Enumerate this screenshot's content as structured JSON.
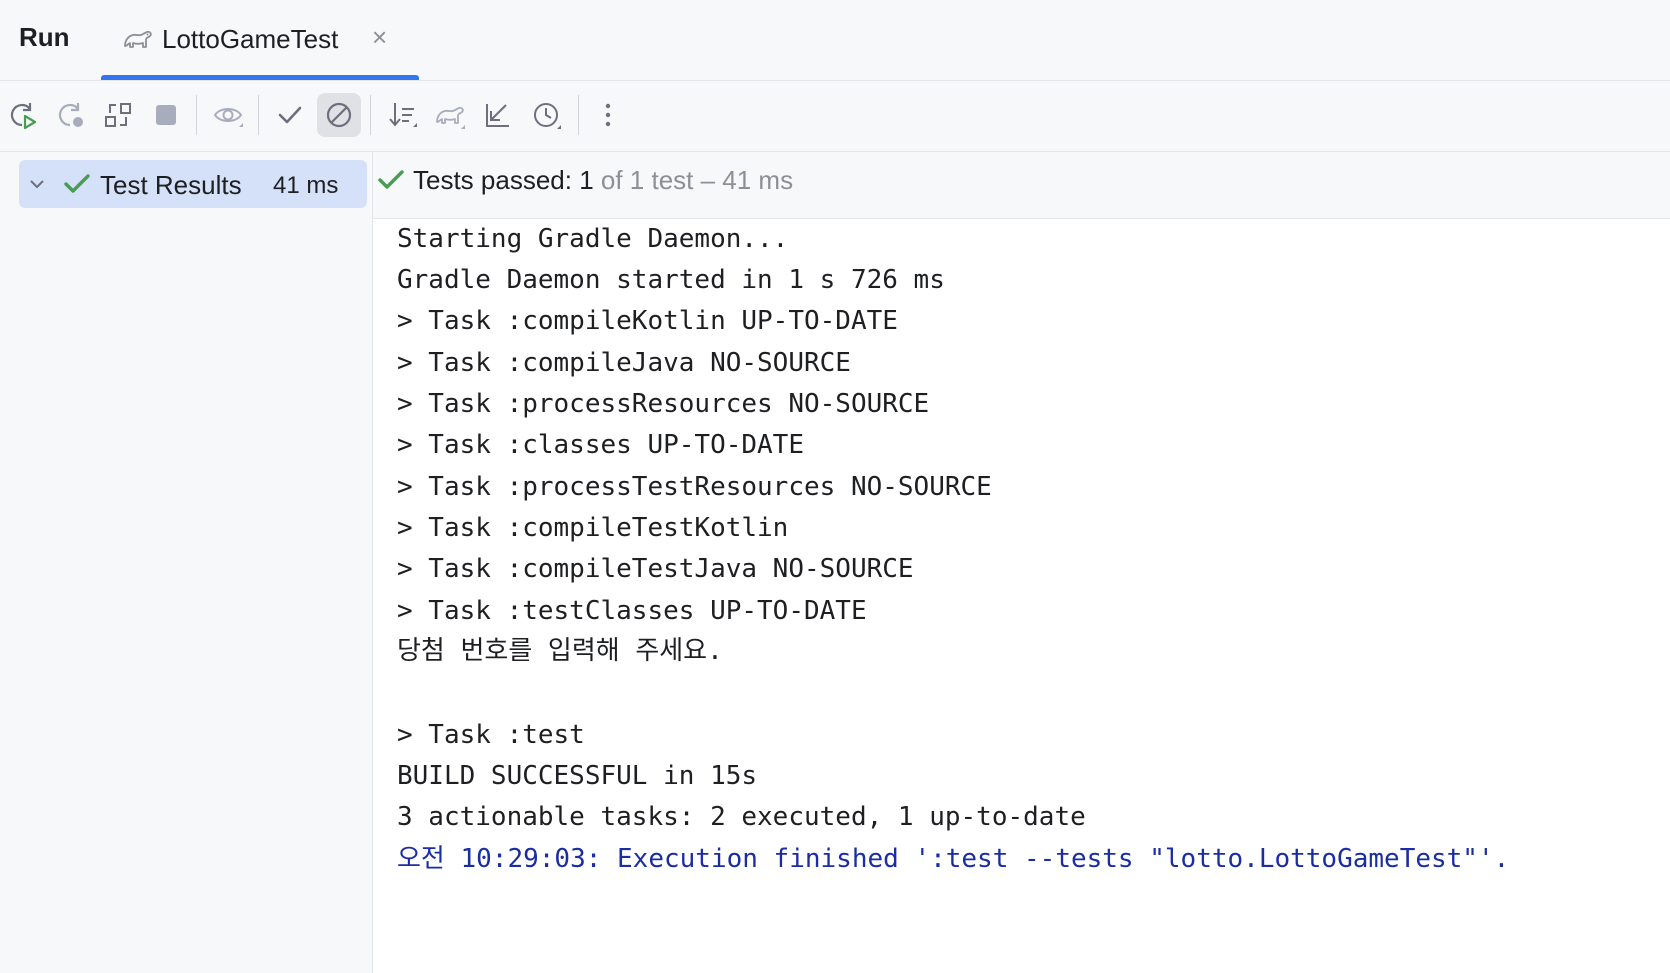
{
  "header": {
    "run_label": "Run",
    "tab_title": "LottoGameTest",
    "tab_close": "×",
    "tab_icon": "gradle-elephant-icon"
  },
  "toolbar": {
    "icons": [
      "rerun-icon",
      "rerun-failed-icon",
      "toggle-auto-test-icon",
      "stop-icon",
      "show-passed-icon",
      "checkmark-icon",
      "show-ignored-icon",
      "sort-icon",
      "gradle-icon",
      "collapse-import-icon",
      "history-icon",
      "more-icon"
    ]
  },
  "tree": {
    "root_label": "Test Results",
    "root_time": "41 ms"
  },
  "status": {
    "passed_label": "Tests passed: 1",
    "detail": " of 1 test – 41 ms",
    "color_pass": "#499c54"
  },
  "console": {
    "lines": [
      "Starting Gradle Daemon...",
      "Gradle Daemon started in 1 s 726 ms",
      "> Task :compileKotlin UP-TO-DATE",
      "> Task :compileJava NO-SOURCE",
      "> Task :processResources NO-SOURCE",
      "> Task :classes UP-TO-DATE",
      "> Task :processTestResources NO-SOURCE",
      "> Task :compileTestKotlin",
      "> Task :compileTestJava NO-SOURCE",
      "> Task :testClasses UP-TO-DATE",
      "당첨 번호를 입력해 주세요.",
      "",
      "> Task :test",
      "BUILD SUCCESSFUL in 15s",
      "3 actionable tasks: 2 executed, 1 up-to-date",
      "오전 10:29:03: Execution finished ':test --tests \"lotto.LottoGameTest\"'."
    ],
    "finished_color": "#1a2da3"
  }
}
